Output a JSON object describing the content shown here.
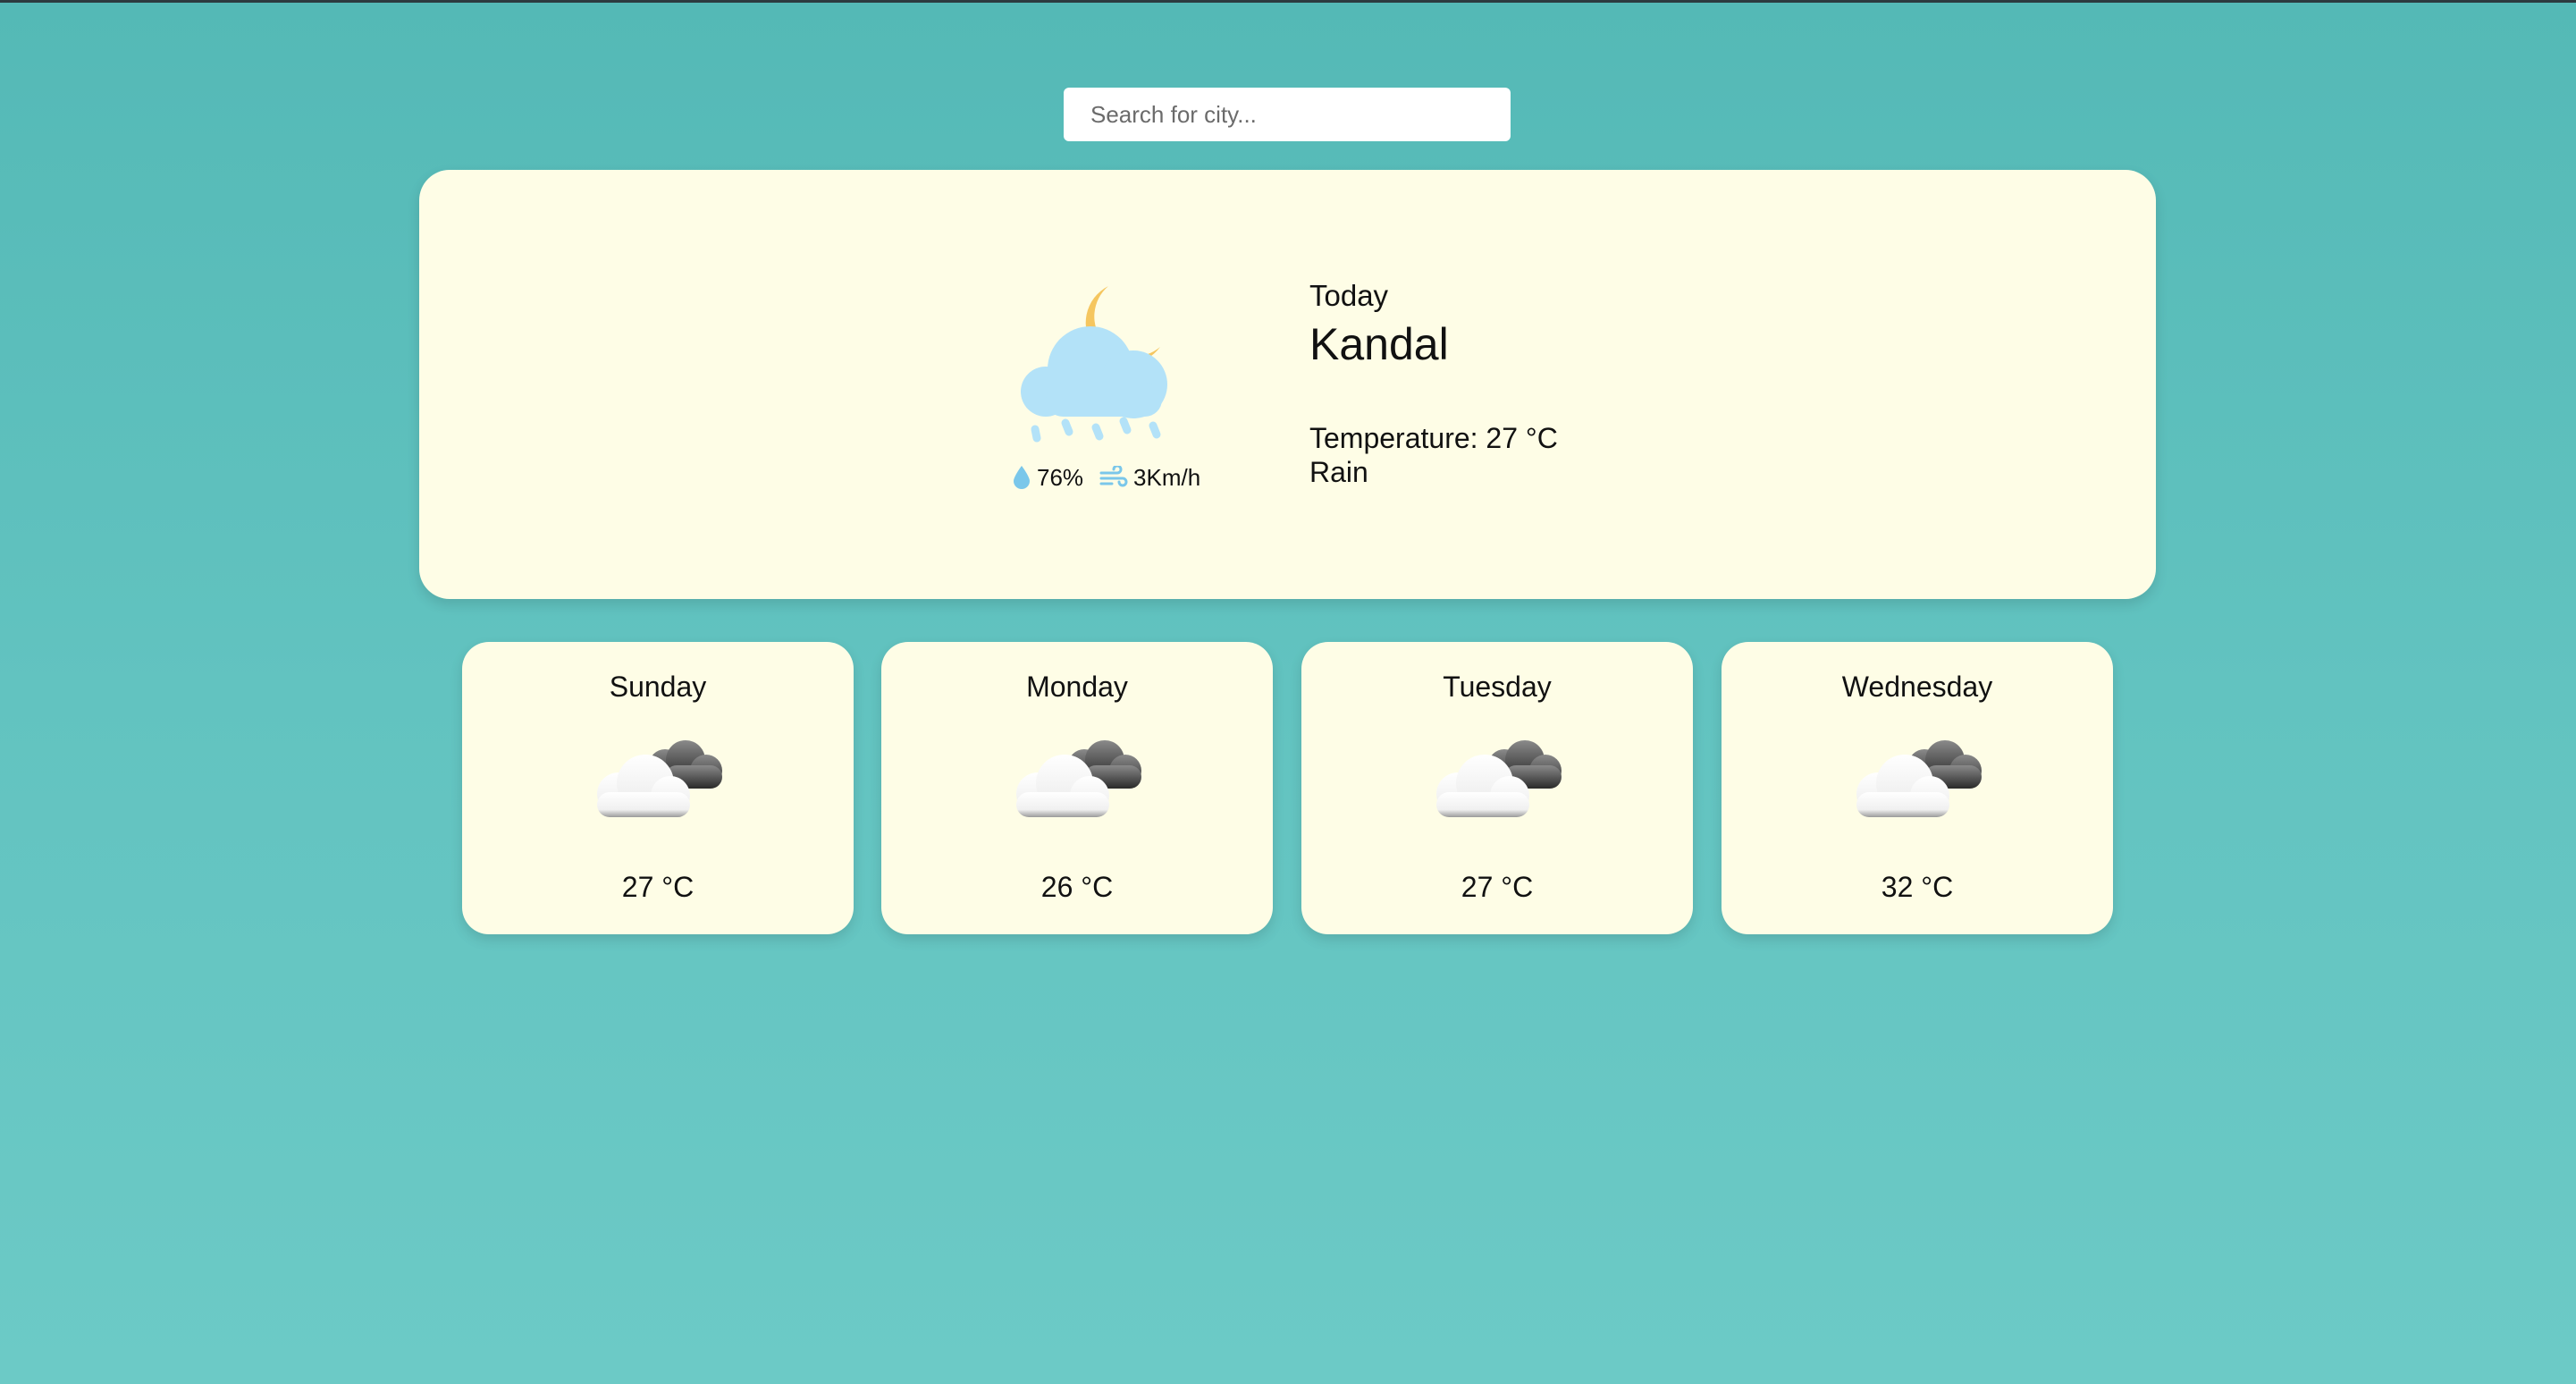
{
  "search": {
    "placeholder": "Search for city..."
  },
  "today": {
    "label": "Today",
    "city": "Kandal",
    "temperature": "Temperature: 27 °C",
    "condition": "Rain",
    "humidity": "76%",
    "wind": "3Km/h",
    "icon": "moon-cloud-rain-icon"
  },
  "forecast": [
    {
      "day": "Sunday",
      "temp": "27 °C",
      "icon": "cloudy-icon"
    },
    {
      "day": "Monday",
      "temp": "26 °C",
      "icon": "cloudy-icon"
    },
    {
      "day": "Tuesday",
      "temp": "27 °C",
      "icon": "cloudy-icon"
    },
    {
      "day": "Wednesday",
      "temp": "32 °C",
      "icon": "cloudy-icon"
    }
  ],
  "colors": {
    "background": "#5fc0bd",
    "card": "#fefde6",
    "cloud_light": "#b3e2f8",
    "moon": "#f5c65f"
  }
}
